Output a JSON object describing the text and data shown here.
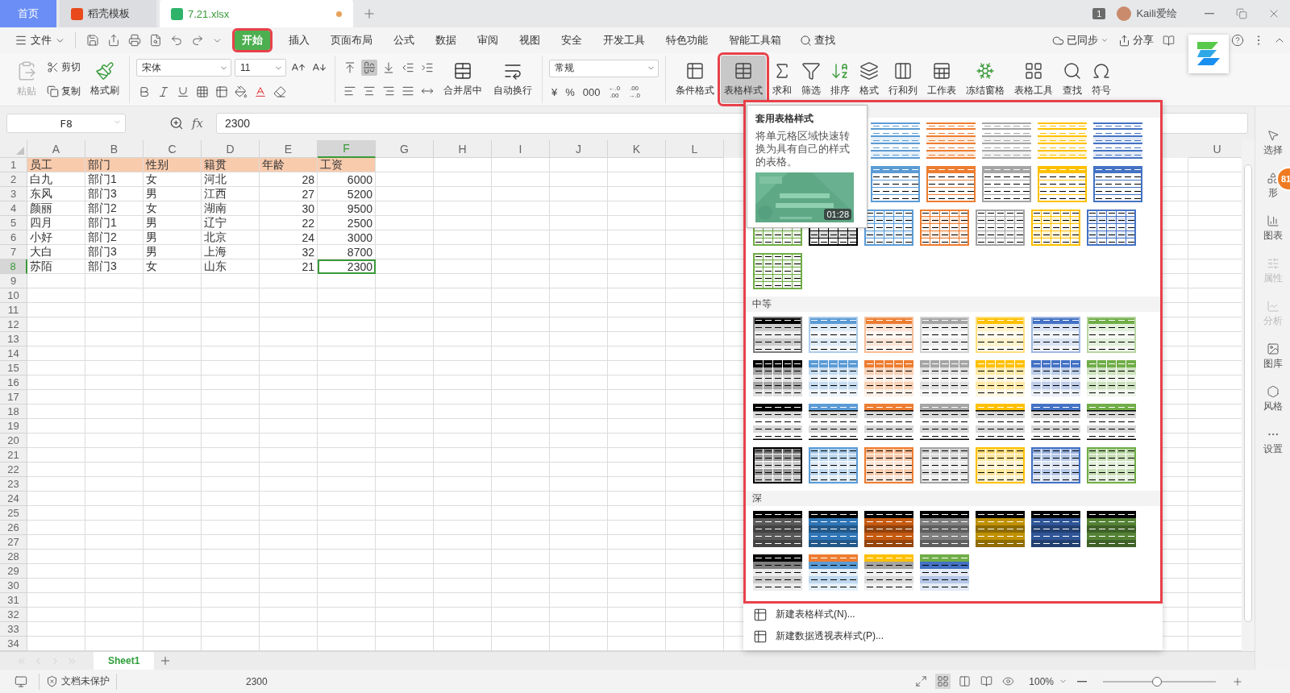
{
  "title_tabs": [
    {
      "label": "首页",
      "kind": "home",
      "selected": false,
      "modified": false
    },
    {
      "label": "稻壳模板",
      "kind": "docer",
      "selected": false,
      "modified": false
    },
    {
      "label": "7.21.xlsx",
      "kind": "sheet",
      "selected": true,
      "modified": true
    }
  ],
  "account": {
    "badge": "1",
    "name": "Kaili爱绘"
  },
  "menu": {
    "file": "文件",
    "tabs": [
      {
        "label": "开始",
        "selected": true
      },
      {
        "label": "插入",
        "selected": false
      },
      {
        "label": "页面布局",
        "selected": false
      },
      {
        "label": "公式",
        "selected": false
      },
      {
        "label": "数据",
        "selected": false
      },
      {
        "label": "审阅",
        "selected": false
      },
      {
        "label": "视图",
        "selected": false
      },
      {
        "label": "安全",
        "selected": false
      },
      {
        "label": "开发工具",
        "selected": false
      },
      {
        "label": "特色功能",
        "selected": false
      },
      {
        "label": "智能工具箱",
        "selected": false
      }
    ],
    "search": "查找",
    "sync": "已同步",
    "share": "分享"
  },
  "ribbon": {
    "clipboard": [
      {
        "label": "粘贴",
        "kind": "paste",
        "disabled": true
      },
      {
        "label": "剪切",
        "kind": "cut",
        "disabled": false
      },
      {
        "label": "复制",
        "kind": "copy",
        "disabled": false
      },
      {
        "label": "格式刷",
        "kind": "brush",
        "disabled": false
      }
    ],
    "font": {
      "name": "宋体",
      "size": "11"
    },
    "vertical_align": [
      {
        "selected": false
      },
      {
        "selected": true
      },
      {
        "selected": false
      }
    ],
    "align_buttons": [
      {
        "label": "合并居中",
        "kind": "merge"
      },
      {
        "label": "自动换行",
        "kind": "wrap"
      }
    ],
    "number_format": "常规",
    "number_buttons": [
      {
        "kind": "currency",
        "text": "¥"
      },
      {
        "kind": "percent",
        "text": "%"
      },
      {
        "kind": "thousands",
        "text": "000"
      },
      {
        "kind": "decimal",
        "lines": [
          "←.0",
          ".00"
        ]
      },
      {
        "kind": "decimal",
        "lines": [
          ".00",
          "→.0"
        ]
      }
    ],
    "tools": [
      {
        "label": "条件格式",
        "kind": "conditional",
        "selected": false
      },
      {
        "label": "表格样式",
        "kind": "table-style",
        "selected": true
      },
      {
        "label": "求和",
        "kind": "sum",
        "selected": false
      },
      {
        "label": "筛选",
        "kind": "filter",
        "selected": false
      },
      {
        "label": "排序",
        "kind": "sort",
        "selected": false
      },
      {
        "label": "格式",
        "kind": "format",
        "selected": false
      },
      {
        "label": "行和列",
        "kind": "rows-cols",
        "selected": false
      },
      {
        "label": "工作表",
        "kind": "worksheet",
        "selected": false
      },
      {
        "label": "冻结窗格",
        "kind": "freeze",
        "selected": false
      },
      {
        "label": "表格工具",
        "kind": "table-tools",
        "selected": false
      },
      {
        "label": "查找",
        "kind": "find",
        "selected": false
      },
      {
        "label": "符号",
        "kind": "symbol",
        "selected": false
      }
    ]
  },
  "formula_bar": {
    "name_box": "F8",
    "fx": "fx",
    "value": "2300"
  },
  "sheet": {
    "columns": [
      {
        "label": "A",
        "kind": "text",
        "selected": false
      },
      {
        "label": "B",
        "kind": "text",
        "selected": false
      },
      {
        "label": "C",
        "kind": "text",
        "selected": false
      },
      {
        "label": "D",
        "kind": "text",
        "selected": false
      },
      {
        "label": "E",
        "kind": "number",
        "selected": false
      },
      {
        "label": "F",
        "kind": "number",
        "selected": true
      },
      {
        "label": "G",
        "kind": "text",
        "selected": false
      },
      {
        "label": "H",
        "kind": "text",
        "selected": false
      },
      {
        "label": "I",
        "kind": "text",
        "selected": false
      },
      {
        "label": "J",
        "kind": "text",
        "selected": false
      },
      {
        "label": "K",
        "kind": "text",
        "selected": false
      },
      {
        "label": "L",
        "kind": "text",
        "selected": false
      },
      {
        "kind": "covered"
      },
      {
        "kind": "covered"
      },
      {
        "kind": "covered"
      },
      {
        "kind": "covered"
      },
      {
        "kind": "covered"
      },
      {
        "kind": "covered"
      },
      {
        "kind": "covered"
      },
      {
        "kind": "covered"
      },
      {
        "label": "U",
        "kind": "text",
        "selected": false
      }
    ],
    "rows": [
      {
        "label": "1",
        "kind": "header",
        "selected": false,
        "cells": [
          "员工",
          "部门",
          "性别",
          "籍贯",
          "年龄",
          "工资"
        ]
      },
      {
        "label": "2",
        "kind": "data",
        "selected": false,
        "cells": [
          "白九",
          "部门1",
          "女",
          "河北",
          "28",
          "6000"
        ]
      },
      {
        "label": "3",
        "kind": "data",
        "selected": false,
        "cells": [
          "东风",
          "部门3",
          "男",
          "江西",
          "27",
          "5200"
        ]
      },
      {
        "label": "4",
        "kind": "data",
        "selected": false,
        "cells": [
          "颜丽",
          "部门2",
          "女",
          "湖南",
          "30",
          "9500"
        ]
      },
      {
        "label": "5",
        "kind": "data",
        "selected": false,
        "cells": [
          "四月",
          "部门1",
          "男",
          "辽宁",
          "22",
          "2500"
        ]
      },
      {
        "label": "6",
        "kind": "data",
        "selected": false,
        "cells": [
          "小好",
          "部门2",
          "男",
          "北京",
          "24",
          "3000"
        ]
      },
      {
        "label": "7",
        "kind": "data",
        "selected": false,
        "cells": [
          "大白",
          "部门3",
          "男",
          "上海",
          "32",
          "8700"
        ]
      },
      {
        "label": "8",
        "kind": "data",
        "selected": true,
        "cells": [
          "苏陌",
          "部门3",
          "女",
          "山东",
          "21",
          "2300"
        ]
      },
      {
        "label": "9",
        "selected": false
      },
      {
        "label": "10",
        "selected": false
      },
      {
        "label": "11",
        "selected": false
      },
      {
        "label": "12",
        "selected": false
      },
      {
        "label": "13",
        "selected": false
      },
      {
        "label": "14",
        "selected": false
      },
      {
        "label": "15",
        "selected": false
      },
      {
        "label": "16",
        "selected": false
      },
      {
        "label": "17",
        "selected": false
      },
      {
        "label": "18",
        "selected": false
      },
      {
        "label": "19",
        "selected": false
      },
      {
        "label": "20",
        "selected": false
      },
      {
        "label": "21",
        "selected": false
      },
      {
        "label": "22",
        "selected": false
      },
      {
        "label": "23",
        "selected": false
      },
      {
        "label": "24",
        "selected": false
      },
      {
        "label": "25",
        "selected": false
      },
      {
        "label": "26",
        "selected": false
      },
      {
        "label": "27",
        "selected": false
      },
      {
        "label": "28",
        "selected": false
      },
      {
        "label": "29",
        "selected": false
      },
      {
        "label": "30",
        "selected": false
      },
      {
        "label": "31",
        "selected": false
      },
      {
        "label": "32",
        "selected": false
      },
      {
        "label": "33",
        "selected": false
      },
      {
        "label": "34",
        "selected": false
      }
    ]
  },
  "sheet_tabs": [
    {
      "label": "Sheet1",
      "selected": true
    }
  ],
  "status_bar": {
    "protection": "文档未保护",
    "value": "2300",
    "zoom": "100%",
    "level": 0.48
  },
  "sidebar": [
    {
      "label": "选择",
      "kind": "select",
      "disabled": false
    },
    {
      "label": "形",
      "kind": "shape",
      "disabled": false
    },
    {
      "label": "图表",
      "kind": "chart",
      "disabled": false
    },
    {
      "label": "属性",
      "kind": "props",
      "disabled": true
    },
    {
      "label": "分析",
      "kind": "analyze",
      "disabled": true
    },
    {
      "label": "图库",
      "kind": "gallery",
      "disabled": false
    },
    {
      "label": "风格",
      "kind": "style",
      "disabled": false
    },
    {
      "label": "设置",
      "kind": "settings",
      "disabled": false
    }
  ],
  "sidebar_badge": "81",
  "gallery": {
    "sections": [
      {
        "rows": [
          {
            "kind": "light-lines",
            "covered": true,
            "swatches": [
              {
                "color": "#5b9bd5"
              },
              {
                "color": "#ed7d31"
              },
              {
                "color": "#a5a5a5"
              },
              {
                "color": "#ffc000"
              },
              {
                "color": "#4472c4"
              }
            ]
          },
          {
            "kind": "light-header",
            "covered": true,
            "swatches": [
              {
                "color": "#5b9bd5"
              },
              {
                "color": "#ed7d31"
              },
              {
                "color": "#a5a5a5"
              },
              {
                "color": "#ffc000"
              },
              {
                "color": "#4472c4"
              }
            ]
          },
          {
            "kind": "light-grid",
            "covered": false,
            "swatches": [
              {
                "color": "#70ad47"
              },
              {
                "color": "#000000"
              },
              {
                "color": "#5b9bd5"
              },
              {
                "color": "#ed7d31"
              },
              {
                "color": "#a5a5a5"
              },
              {
                "color": "#ffc000"
              },
              {
                "color": "#4472c4"
              }
            ]
          },
          {
            "kind": "light-grid",
            "covered": false,
            "swatches": [
              {
                "color": "#70ad47"
              }
            ]
          }
        ]
      },
      {
        "title": "中等",
        "rows": [
          {
            "kind": "medium-banded",
            "swatches": [
              {
                "color": "#000000"
              },
              {
                "color": "#5b9bd5"
              },
              {
                "color": "#ed7d31"
              },
              {
                "color": "#a5a5a5"
              },
              {
                "color": "#ffc000"
              },
              {
                "color": "#4472c4"
              },
              {
                "color": "#70ad47"
              }
            ]
          },
          {
            "kind": "medium-columns",
            "swatches": [
              {
                "color": "#000000"
              },
              {
                "color": "#5b9bd5"
              },
              {
                "color": "#ed7d31"
              },
              {
                "color": "#a5a5a5"
              },
              {
                "color": "#ffc000"
              },
              {
                "color": "#4472c4"
              },
              {
                "color": "#70ad47"
              }
            ]
          },
          {
            "kind": "medium-topbar",
            "swatches": [
              {
                "color": "#000000"
              },
              {
                "color": "#5b9bd5"
              },
              {
                "color": "#ed7d31"
              },
              {
                "color": "#a5a5a5"
              },
              {
                "color": "#ffc000"
              },
              {
                "color": "#4472c4"
              },
              {
                "color": "#70ad47"
              }
            ]
          },
          {
            "kind": "medium-grid",
            "swatches": [
              {
                "color": "#000000"
              },
              {
                "color": "#5b9bd5"
              },
              {
                "color": "#ed7d31"
              },
              {
                "color": "#a5a5a5"
              },
              {
                "color": "#ffc000"
              },
              {
                "color": "#4472c4"
              },
              {
                "color": "#70ad47"
              }
            ]
          }
        ]
      },
      {
        "title": "深",
        "rows": [
          {
            "kind": "dark-solid",
            "swatches": [
              {
                "color": "#595959"
              },
              {
                "color": "#2e75b6"
              },
              {
                "color": "#c55a11"
              },
              {
                "color": "#7f7f7f"
              },
              {
                "color": "#bf9000"
              },
              {
                "color": "#2f5597"
              },
              {
                "color": "#548235"
              }
            ]
          },
          {
            "kind": "dark-header",
            "swatches": [
              {
                "color": "#000000",
                "body": {
                  "color": "#7f7f7f"
                }
              },
              {
                "color": "#ed7d31",
                "body": {
                  "color": "#5b9bd5"
                }
              },
              {
                "color": "#ffc000",
                "body": {
                  "color": "#a5a5a5"
                }
              },
              {
                "color": "#70ad47",
                "body": {
                  "color": "#4472c4"
                }
              }
            ]
          }
        ]
      }
    ],
    "actions": [
      "新建表格样式(N)...",
      "新建数据透视表样式(P)..."
    ]
  },
  "tooltip": {
    "title": "套用表格样式",
    "text": "将单元格区域快速转换为具有自己的样式的表格。",
    "duration": "01:28"
  }
}
